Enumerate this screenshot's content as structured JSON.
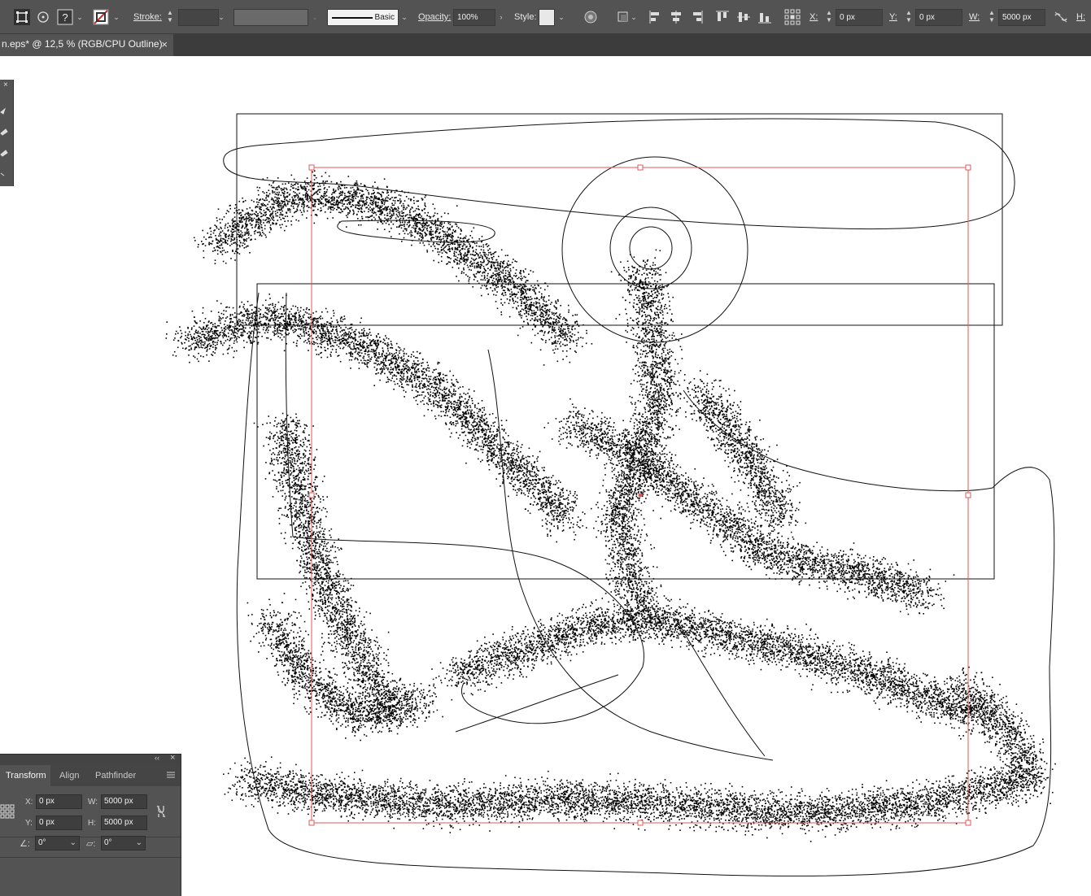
{
  "control_bar": {
    "stroke_label": "Stroke:",
    "stroke_weight": "",
    "stroke_profile": "Basic",
    "opacity_label": "Opacity:",
    "opacity_value": "100%",
    "style_label": "Style:",
    "x_label": "X:",
    "x_value": "0 px",
    "y_label": "Y:",
    "y_value": "0 px",
    "w_label": "W:",
    "w_value": "5000 px",
    "h_label": "H:",
    "fill_icon": "question-mark-icon",
    "stroke_icon": "none-swatch-icon",
    "colors": {
      "bar_bg": "#535353",
      "tab_bg": "#3c3c3c",
      "bounding_box": "#e05a5a"
    }
  },
  "document": {
    "tab_title": "n.eps* @ 12,5 % (RGB/CPU Outline)",
    "close_glyph": "×"
  },
  "transform_panel": {
    "tabs": [
      "Transform",
      "Align",
      "Pathfinder"
    ],
    "active_tab": "Transform",
    "x_label": "X:",
    "x_value": "0 px",
    "y_label": "Y:",
    "y_value": "0 px",
    "w_label": "W:",
    "w_value": "5000 px",
    "h_label": "H:",
    "h_value": "5000 px",
    "angle_value": "0°",
    "shear_value": "0°",
    "menu_icon": "panel-menu-icon",
    "collapse_glyph": "‹‹",
    "close_glyph": "×"
  }
}
